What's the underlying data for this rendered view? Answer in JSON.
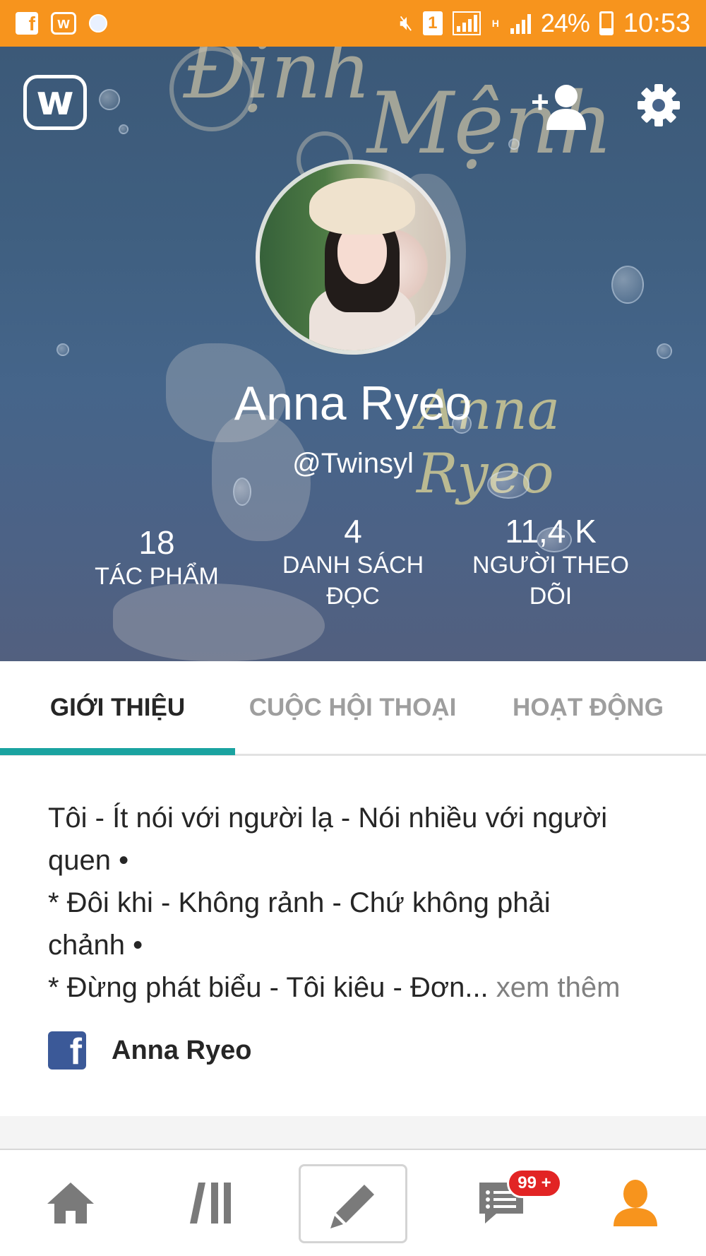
{
  "status_bar": {
    "notification_icons": [
      "facebook-icon",
      "wattpad-icon",
      "app-icon"
    ],
    "sim_slot": "1",
    "network_type": "H",
    "battery_percent": "24%",
    "time": "10:53"
  },
  "header": {
    "logo_letter": "w",
    "profile_name": "Anna Ryeo",
    "username": "@Twinsyl",
    "cover_title_lines": [
      "Định",
      "Mệnh"
    ],
    "cover_author": "Anna Ryeo",
    "stats": [
      {
        "value": "18",
        "label": "TÁC PHẨM"
      },
      {
        "value": "4",
        "label": "DANH SÁCH ĐỌC"
      },
      {
        "value": "11,4 K",
        "label": "NGƯỜI THEO DÕI"
      }
    ],
    "stat_label_lines": [
      [
        "TÁC PHẨM"
      ],
      [
        "DANH SÁCH",
        "ĐỌC"
      ],
      [
        "NGƯỜI THEO",
        "DÕI"
      ]
    ]
  },
  "tabs": [
    {
      "label": "GIỚI THIỆU",
      "active": true
    },
    {
      "label": "CUỘC HỘI THOẠI",
      "active": false
    },
    {
      "label": "HOẠT ĐỘNG",
      "active": false
    }
  ],
  "about": {
    "lines": [
      "Tôi - Ít nói với người lạ - Nói nhiều với người",
      "quen •",
      "* Đôi khi - Không rảnh - Chứ không phải",
      "chảnh •",
      "* Đừng phát biểu - Tôi kiêu - Đơn..."
    ],
    "see_more": "xem thêm",
    "facebook_name": "Anna Ryeo"
  },
  "bottom_nav": {
    "items": [
      "home-icon",
      "library-icon",
      "write-icon",
      "messages-icon",
      "profile-icon"
    ],
    "messages_badge": "99 +",
    "active_item": "profile-icon"
  },
  "colors": {
    "status_bar": "#f7941d",
    "tab_indicator": "#1aa3a0",
    "active_nav": "#f7941d",
    "inactive_nav": "#7a7a7a",
    "badge": "#e22424",
    "facebook": "#3b5998"
  }
}
